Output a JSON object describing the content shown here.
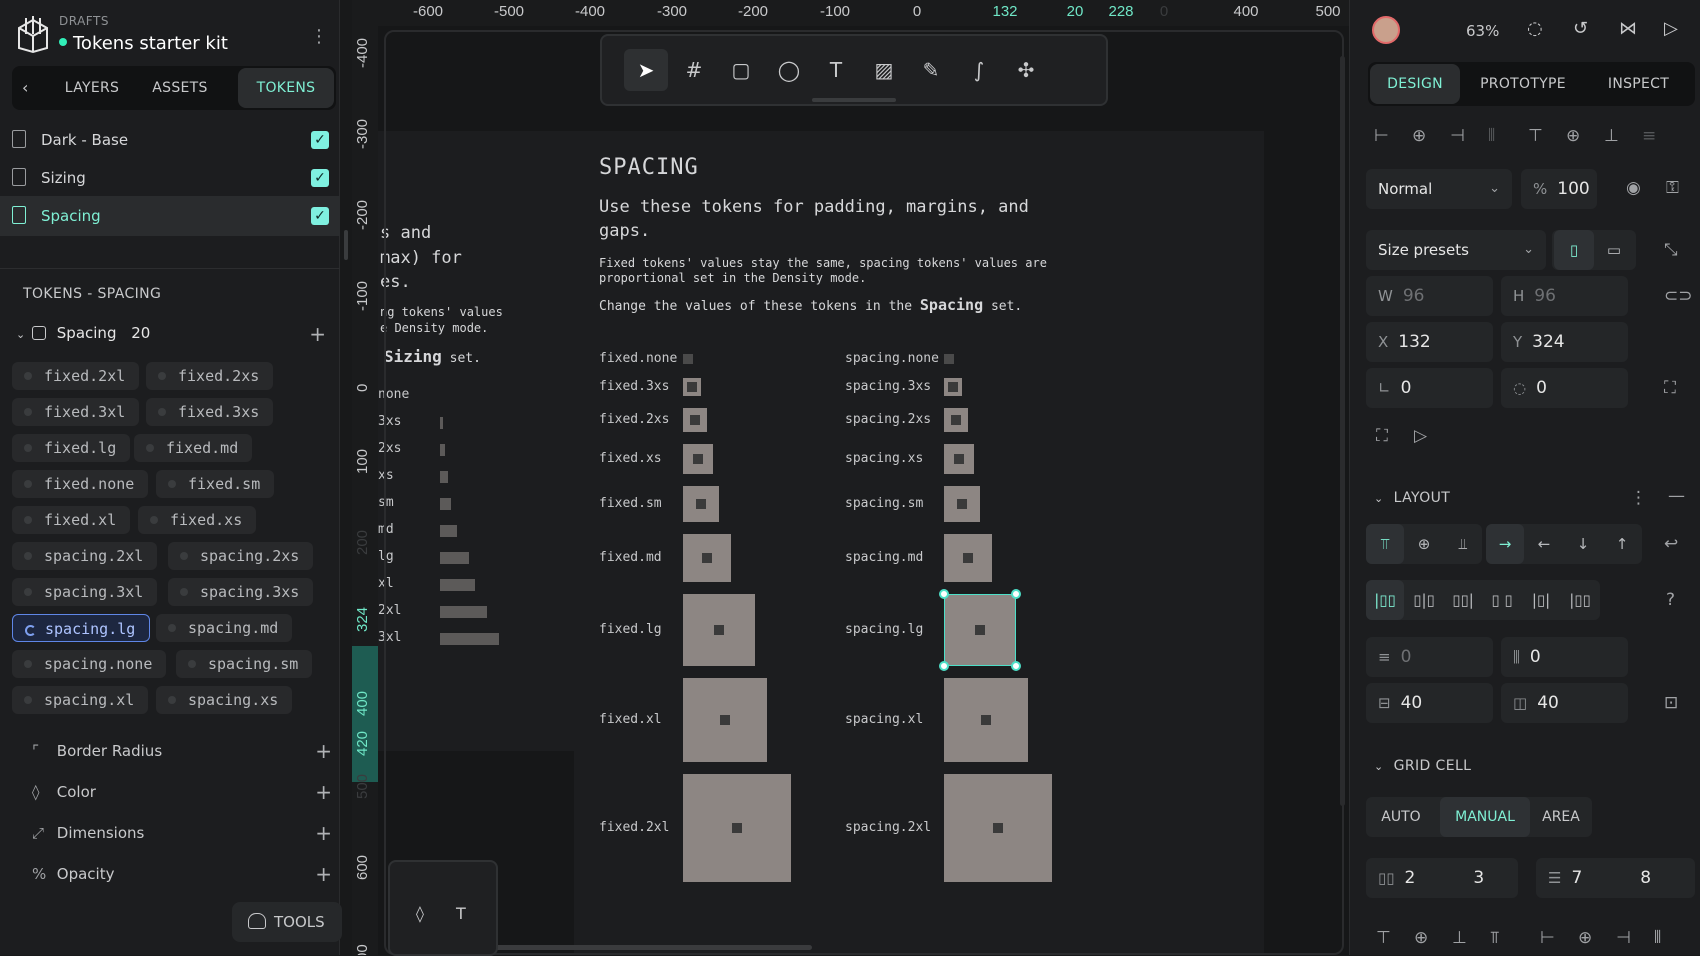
{
  "sidebar": {
    "drafts_label": "DRAFTS",
    "project_name": "Tokens starter kit",
    "tabs": [
      {
        "label": "LAYERS"
      },
      {
        "label": "ASSETS"
      },
      {
        "label": "TOKENS"
      }
    ],
    "sets": [
      {
        "label": "Dark - Base",
        "checked": true
      },
      {
        "label": "Sizing",
        "checked": true
      },
      {
        "label": "Spacing",
        "checked": true
      }
    ],
    "tokens_heading": "TOKENS - SPACING",
    "group": {
      "label": "Spacing",
      "count": "20"
    },
    "pills": [
      "fixed.2xl",
      "fixed.2xs",
      "fixed.3xl",
      "fixed.3xs",
      "fixed.lg",
      "fixed.md",
      "fixed.none",
      "fixed.sm",
      "fixed.xl",
      "fixed.xs",
      "spacing.2xl",
      "spacing.2xs",
      "spacing.3xl",
      "spacing.3xs",
      "spacing.lg",
      "spacing.md",
      "spacing.none",
      "spacing.sm",
      "spacing.xl",
      "spacing.xs"
    ],
    "categories": [
      {
        "label": "Border Radius",
        "icon": "corner-icon"
      },
      {
        "label": "Color",
        "icon": "drop-icon"
      },
      {
        "label": "Dimensions",
        "icon": "dimension-icon"
      },
      {
        "label": "Opacity",
        "icon": "percent-icon"
      }
    ],
    "tools_label": "TOOLS"
  },
  "ruler_top": [
    "-600",
    "-500",
    "-400",
    "-300",
    "-200",
    "-100",
    "0",
    "132",
    "20",
    "228",
    "0",
    "400",
    "500"
  ],
  "ruler_left": [
    "-400",
    "-300",
    "-200",
    "-100",
    "0",
    "100",
    "200",
    "324",
    "400",
    "420",
    "500",
    "600",
    "00"
  ],
  "canvas": {
    "left_board": {
      "line1": "s and",
      "line2": "max) for",
      "line3": "es.",
      "body1": "ng tokens' values",
      "body2": "e Density mode.",
      "set_name": "Sizing",
      "set_suffix": " set.",
      "rows": [
        "none",
        "3xs",
        "2xs",
        "xs",
        "sm",
        "md",
        "lg",
        "xl",
        "2xl",
        "3xl"
      ]
    },
    "title": "SPACING",
    "subtitle_1": "Use these tokens for padding, margins, and",
    "subtitle_2": "gaps.",
    "body_1": "Fixed tokens' values stay the same, spacing tokens' values are",
    "body_2": "proportional set in the Density mode.",
    "change_prefix": "Change the values of these tokens in the ",
    "change_set": "Spacing",
    "change_suffix": " set.",
    "fixed_rows": [
      "fixed.none",
      "fixed.3xs",
      "fixed.2xs",
      "fixed.xs",
      "fixed.sm",
      "fixed.md",
      "fixed.lg",
      "fixed.xl",
      "fixed.2xl"
    ],
    "spacing_rows": [
      "spacing.none",
      "spacing.3xs",
      "spacing.2xs",
      "spacing.xs",
      "spacing.sm",
      "spacing.md",
      "spacing.lg",
      "spacing.xl",
      "spacing.2xl"
    ]
  },
  "right": {
    "zoom": "63%",
    "tabs": [
      {
        "label": "DESIGN"
      },
      {
        "label": "PROTOTYPE"
      },
      {
        "label": "INSPECT"
      }
    ],
    "blend": "Normal",
    "opacity_prefix": "%",
    "opacity": "100",
    "size_presets": "Size presets",
    "w_label": "W",
    "w": "96",
    "h_label": "H",
    "h": "96",
    "x_label": "X",
    "x": "132",
    "y_label": "Y",
    "y": "324",
    "rotation": "0",
    "radius": "0",
    "layout_heading": "LAYOUT",
    "gap_row": "0",
    "gap_col": "0",
    "pad_v": "40",
    "pad_h": "40",
    "grid_heading": "GRID CELL",
    "grid_modes": [
      {
        "label": "AUTO"
      },
      {
        "label": "MANUAL"
      },
      {
        "label": "AREA"
      }
    ],
    "col_start": "2",
    "col_end": "3",
    "row_start": "7",
    "row_end": "8"
  }
}
